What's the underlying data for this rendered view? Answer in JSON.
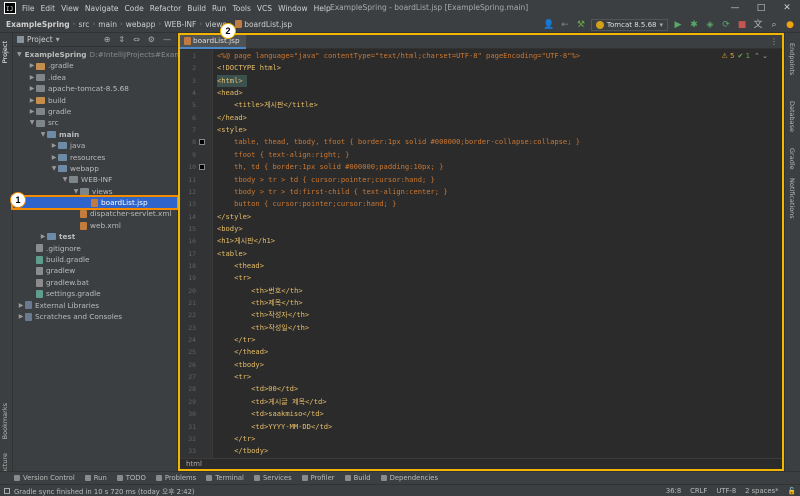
{
  "window": {
    "title": "ExampleSpring - boardList.jsp [ExampleSpring.main]",
    "menu": [
      "File",
      "Edit",
      "View",
      "Navigate",
      "Code",
      "Refactor",
      "Build",
      "Run",
      "Tools",
      "VCS",
      "Window",
      "Help"
    ],
    "controls": [
      "—",
      "□",
      "✕"
    ]
  },
  "navbar": {
    "crumbs": [
      "ExampleSpring",
      "src",
      "main",
      "webapp",
      "WEB-INF",
      "views"
    ],
    "file": "boardList.jsp",
    "run_config": "Tomcat 8.5.68"
  },
  "left_stripe": {
    "project": "Project",
    "bookmarks": "Bookmarks",
    "structure": "Structure"
  },
  "right_stripe": {
    "endpoints": "Endpoints",
    "database": "Database",
    "gradle": "Gradle",
    "notifications": "Notifications"
  },
  "project_panel": {
    "title": "Project",
    "tree": [
      {
        "label": "ExampleSpring",
        "path": "D:#IntelliJProjects#Example",
        "indent": 0,
        "arrow": "v",
        "icon": "blue",
        "bold": true
      },
      {
        "label": ".gradle",
        "indent": 1,
        "arrow": ">",
        "icon": "orange"
      },
      {
        "label": ".idea",
        "indent": 1,
        "arrow": ">",
        "icon": "gray"
      },
      {
        "label": "apache-tomcat-8.5.68",
        "indent": 1,
        "arrow": ">",
        "icon": "gray"
      },
      {
        "label": "build",
        "indent": 1,
        "arrow": ">",
        "icon": "orange"
      },
      {
        "label": "gradle",
        "indent": 1,
        "arrow": ">",
        "icon": "gray"
      },
      {
        "label": "src",
        "indent": 1,
        "arrow": "v",
        "icon": "gray"
      },
      {
        "label": "main",
        "indent": 2,
        "arrow": "v",
        "icon": "src",
        "bold": true
      },
      {
        "label": "java",
        "indent": 3,
        "arrow": ">",
        "icon": "src"
      },
      {
        "label": "resources",
        "indent": 3,
        "arrow": ">",
        "icon": "src"
      },
      {
        "label": "webapp",
        "indent": 3,
        "arrow": "v",
        "icon": "src"
      },
      {
        "label": "WEB-INF",
        "indent": 4,
        "arrow": "v",
        "icon": "gray"
      },
      {
        "label": "views",
        "indent": 5,
        "arrow": "v",
        "icon": "gray"
      },
      {
        "label": "boardList.jsp",
        "indent": 6,
        "arrow": "",
        "icon": "jsp",
        "selected": true
      },
      {
        "label": "dispatcher-servlet.xml",
        "indent": 5,
        "arrow": "",
        "icon": "xml"
      },
      {
        "label": "web.xml",
        "indent": 5,
        "arrow": "",
        "icon": "xml"
      },
      {
        "label": "test",
        "indent": 2,
        "arrow": ">",
        "icon": "src",
        "bold": true
      },
      {
        "label": ".gitignore",
        "indent": 1,
        "arrow": "",
        "icon": "txt"
      },
      {
        "label": "build.gradle",
        "indent": 1,
        "arrow": "",
        "icon": "gradle"
      },
      {
        "label": "gradlew",
        "indent": 1,
        "arrow": "",
        "icon": "txt"
      },
      {
        "label": "gradlew.bat",
        "indent": 1,
        "arrow": "",
        "icon": "txt"
      },
      {
        "label": "settings.gradle",
        "indent": 1,
        "arrow": "",
        "icon": "gradle"
      },
      {
        "label": "External Libraries",
        "indent": 0,
        "arrow": ">",
        "icon": "lib"
      },
      {
        "label": "Scratches and Consoles",
        "indent": 0,
        "arrow": ">",
        "icon": "lib"
      }
    ]
  },
  "callouts": {
    "one": "1",
    "two": "2"
  },
  "editor": {
    "tab": "boardList.jsp",
    "inspection": {
      "warnings": "⚠ 5",
      "typos": "✔ 1",
      "chevrons": "⌃ ⌄"
    },
    "bottom_breadcrumb": "html",
    "lines": [
      "<%@ page language=\"java\" contentType=\"text/html;charset=UTF-8\" pageEncoding=\"UTF-8\"%>",
      "<!DOCTYPE html>",
      "<html>",
      "<head>",
      "    <title>게시판</title>",
      "</head>",
      "<style>",
      "    table, thead, tbody, tfoot { border:1px solid #000000;border-collapse:collapse; }",
      "    tfoot { text-align:right; }",
      "    th, td { border:1px solid #000000;padding:10px; }",
      "    tbody > tr > td { cursor:pointer;cursor:hand; }",
      "    tbody > tr > td:first-child { text-align:center; }",
      "    button { cursor:pointer;cursor:hand; }",
      "</style>",
      "<body>",
      "<h1>게시판</h1>",
      "<table>",
      "    <thead>",
      "    <tr>",
      "        <th>번호</th>",
      "        <th>제목</th>",
      "        <th>작성자</th>",
      "        <th>작성일</th>",
      "    </tr>",
      "    </thead>",
      "    <tbody>",
      "    <tr>",
      "        <td>00</td>",
      "        <td>게시글 제목</td>",
      "        <td>saakmiso</td>",
      "        <td>YYYY-MM-DD</td>",
      "    </tr>",
      "    </tbody>"
    ]
  },
  "bottom_tools": [
    "Version Control",
    "Run",
    "TODO",
    "Problems",
    "Terminal",
    "Services",
    "Profiler",
    "Build",
    "Dependencies"
  ],
  "status": {
    "message": "Gradle sync finished in 10 s 720 ms (today 오후 2:42)",
    "position": "36:8",
    "line_sep": "CRLF",
    "encoding": "UTF-8",
    "indent": "2 spaces*"
  },
  "colors": {
    "selection": "#2f65ca",
    "callout_border_1": "#f28b00",
    "callout_border_2": "#f2b600"
  }
}
